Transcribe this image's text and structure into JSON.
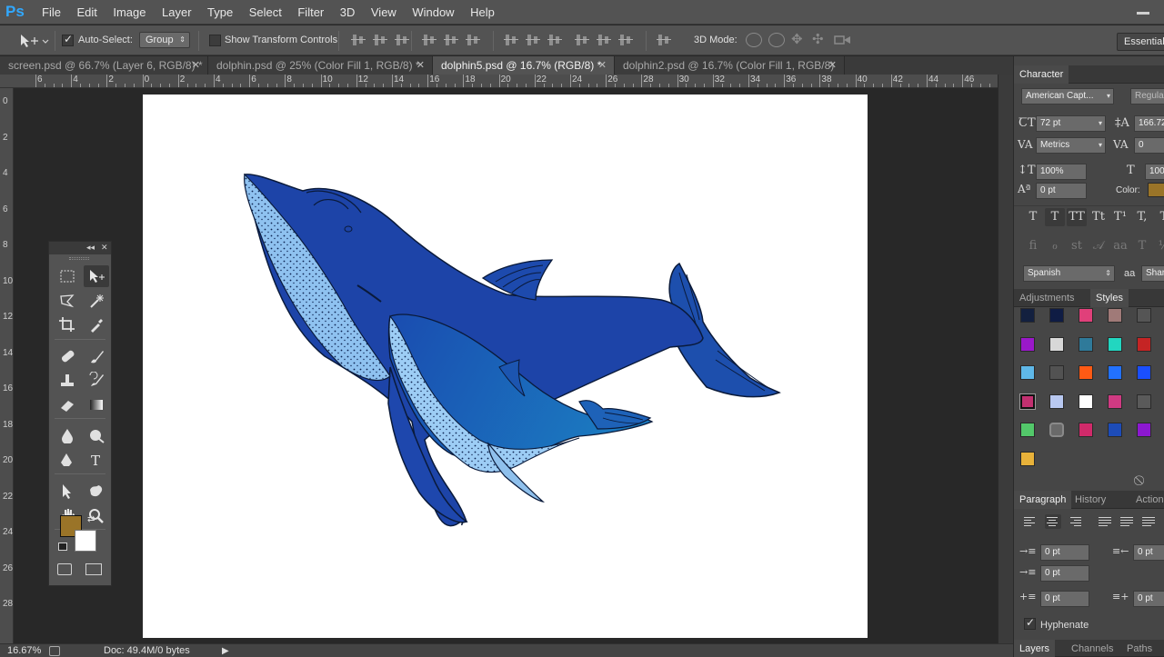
{
  "app": {
    "logo": "Ps",
    "window_control": "minimize"
  },
  "menu": [
    "File",
    "Edit",
    "Image",
    "Layer",
    "Type",
    "Select",
    "Filter",
    "3D",
    "View",
    "Window",
    "Help"
  ],
  "options_bar": {
    "auto_select_label": "Auto-Select:",
    "auto_select_checked": true,
    "auto_select_mode": "Group",
    "show_transform_label": "Show Transform Controls",
    "show_transform_checked": false,
    "mode_3d_label": "3D Mode:",
    "workspace": "Essentials"
  },
  "tabs": [
    {
      "label": "screen.psd @ 66.7% (Layer 6, RGB/8) *",
      "active": false
    },
    {
      "label": "dolphin.psd @ 25% (Color Fill 1, RGB/8) *",
      "active": false
    },
    {
      "label": "dolphin5.psd @ 16.7% (RGB/8) *",
      "active": true
    },
    {
      "label": "dolphin2.psd @ 16.7% (Color Fill 1, RGB/8)",
      "active": false
    }
  ],
  "ruler": {
    "h_labels": [
      "6",
      "4",
      "2",
      "0",
      "2",
      "4",
      "6",
      "8",
      "10",
      "12",
      "14",
      "16",
      "18",
      "20",
      "22",
      "24",
      "26",
      "28",
      "30",
      "32",
      "34",
      "36",
      "38",
      "40",
      "42",
      "44",
      "46"
    ],
    "v_labels": [
      "0",
      "2",
      "4",
      "6",
      "8",
      "10",
      "12",
      "14",
      "16",
      "18",
      "20",
      "22",
      "24",
      "26",
      "28"
    ]
  },
  "status": {
    "zoom": "16.67%",
    "doc": "Doc: 49.4M/0 bytes"
  },
  "colors": {
    "foreground": "#9a7428",
    "background": "#ffffff",
    "whale_body": "#1c43a3",
    "whale_belly": "#8fc2f0",
    "calf_body": "#1e62b8"
  },
  "tools": [
    [
      "rect-marquee-icon",
      "move-icon"
    ],
    [
      "lasso-icon",
      "magic-wand-icon"
    ],
    [
      "crop-icon",
      "eyedropper-icon"
    ],
    [
      "healing-brush-icon",
      "brush-icon"
    ],
    [
      "clone-stamp-icon",
      "history-brush-icon"
    ],
    [
      "eraser-icon",
      "gradient-icon"
    ],
    [
      "blur-icon",
      "dodge-icon"
    ],
    [
      "pen-icon",
      "type-icon"
    ],
    [
      "path-select-icon",
      "custom-shape-icon"
    ],
    [
      "hand-icon",
      "zoom-icon"
    ]
  ],
  "character": {
    "tab": "Character",
    "font_family": "American Capt...",
    "font_style": "Regular",
    "size": "72 pt",
    "leading": "166.72",
    "kerning": "Metrics",
    "tracking": "0",
    "vscale": "100%",
    "hscale": "100",
    "baseline": "0 pt",
    "color_label": "Color:",
    "color": "#9a7428",
    "language": "Spanish",
    "aa_label": "aa",
    "antialias": "Sharp"
  },
  "styles_panel": {
    "tabs": [
      "Adjustments",
      "Styles"
    ],
    "swatches": [
      "#13203f",
      "#0f1c44",
      "#e0407a",
      "#a07a78",
      "#555555",
      "#9a18c9",
      "#d8d8d8",
      "#2f7a9a",
      "#22d6c0",
      "#c52424",
      "#5fb8e8",
      "#525252",
      "#ff5a14",
      "#2271ff",
      "#1a4fff",
      "#c23070",
      "#b8c8f0",
      "#ffffff",
      "#cf3a82",
      "#5a5a5a",
      "#53c86a",
      "#6a6a6a",
      "#d02a6a",
      "#1d4cb8",
      "#8c18d0",
      "#e8b23a"
    ]
  },
  "paragraph": {
    "tabs": [
      "Paragraph",
      "History",
      "Actions"
    ],
    "indent_left": "0 pt",
    "indent_right": "0 pt",
    "indent_first": "0 pt",
    "space_before": "0 pt",
    "space_after": "0 pt",
    "hyphenate_label": "Hyphenate",
    "hyphenate_checked": true
  },
  "bottom_tabs": [
    "Layers",
    "Channels",
    "Paths"
  ]
}
